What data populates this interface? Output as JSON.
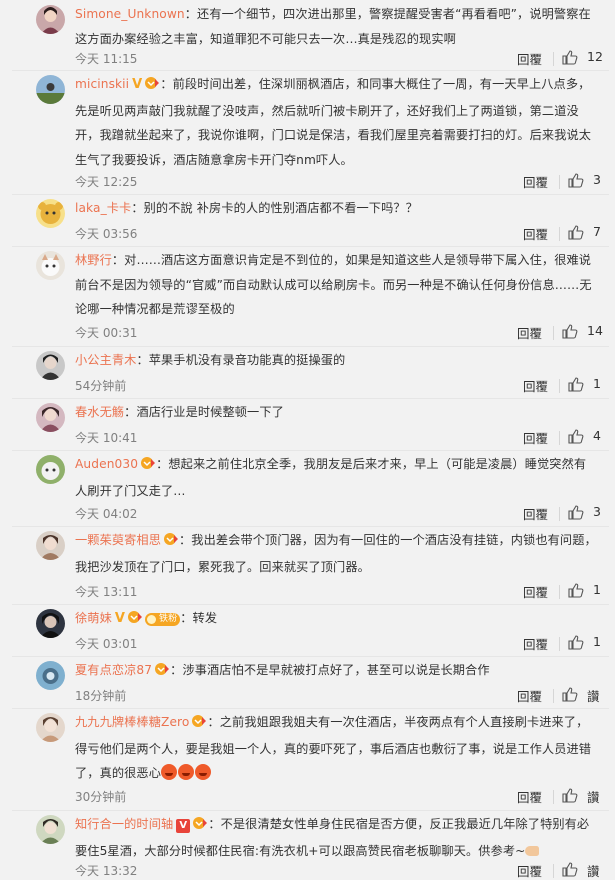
{
  "comments": [
    {
      "user": "Simone_Unknown",
      "text": "：还有一个细节，四次进出那里，警察提醒受害者“再看看吧”，说明警察在这方面办案经验之丰富，知道罪犯不可能只去一次…真是残忍的现实啊",
      "time": "今天 11:15",
      "reply": "回覆",
      "likes": "12"
    },
    {
      "user": "micinskii",
      "text": "：前段时间出差，住深圳丽枫酒店，和同事大概住了一周，有一天早上八点多，先是听见两声敲门我就醒了没吱声，然后就听门被卡刷开了，还好我们上了两道锁，第二道没开，我蹭就坐起来了，我说你谁啊，门口说是保洁，看我们屋里亮着需要打扫的灯。后来我说太生气了我要投诉，酒店随意拿房卡开门夺nm吓人。",
      "time": "今天 12:25",
      "reply": "回覆",
      "likes": "3"
    },
    {
      "user": "laka_卡卡",
      "text": "：别的不說 补房卡的人的性别酒店都不看一下吗？？",
      "time": "今天 03:56",
      "reply": "回覆",
      "likes": "7"
    },
    {
      "user": "林野行",
      "text": "：对……酒店这方面意识肯定是不到位的，如果是知道这些人是领导带下属入住，很难说前台不是因为领导的“官威”而自动默认成可以给刷房卡。而另一种是不确认任何身份信息……无论哪一种情况都是荒谬至极的",
      "time": "今天 00:31",
      "reply": "回覆",
      "likes": "14"
    },
    {
      "user": "小公主青木",
      "text": "：苹果手机没有录音功能真的挺操蛋的",
      "time": "54分钟前",
      "reply": "回覆",
      "likes": "1"
    },
    {
      "user": "春水无觞",
      "text": "：酒店行业是时候整顿一下了",
      "time": "今天 10:41",
      "reply": "回覆",
      "likes": "4"
    },
    {
      "user": "Auden030",
      "text": "：想起来之前住北京全季，我朋友是后来才来，早上（可能是凌晨）睡觉突然有人刷开了门又走了…",
      "time": "今天 04:02",
      "reply": "回覆",
      "likes": "3"
    },
    {
      "user": "一颗茱萸寄相思",
      "text": "：我出差会带个顶门器，因为有一回住的一个酒店没有挂链，内锁也有问题，我把沙发顶在了门口，累死我了。回来就买了顶门器。",
      "time": "今天 13:11",
      "reply": "回覆",
      "likes": "1"
    },
    {
      "user": "徐萌妹",
      "fan_badge": "铁粉",
      "text": "：转发",
      "time": "今天 03:01",
      "reply": "回覆",
      "likes": "1"
    },
    {
      "user": "夏有点恋凉87",
      "text": "：涉事酒店怕不是早就被打点好了，甚至可以说是长期合作",
      "time": "18分钟前",
      "reply": "回覆",
      "likes": "讚"
    },
    {
      "user": "九九九牌棒棒糖Zero",
      "text": "：之前我姐跟我姐夫有一次住酒店，半夜两点有个人直接刷卡进来了，得亏他们是两个人，要是我姐一个人，真的要吓死了，事后酒店也敷衍了事，说是工作人员进错了，真的很恶心",
      "time": "30分钟前",
      "reply": "回覆",
      "likes": "讚"
    },
    {
      "user": "知行合一的时间轴",
      "text": "：不是很清楚女性单身住民宿是否方便，反正我最近几年除了特别有必要住5星酒，大部分时候都住民宿:有洗衣机+可以跟高赞民宿老板聊聊天。供参考~",
      "time": "今天 13:32",
      "reply": "回覆",
      "likes": "讚"
    }
  ]
}
